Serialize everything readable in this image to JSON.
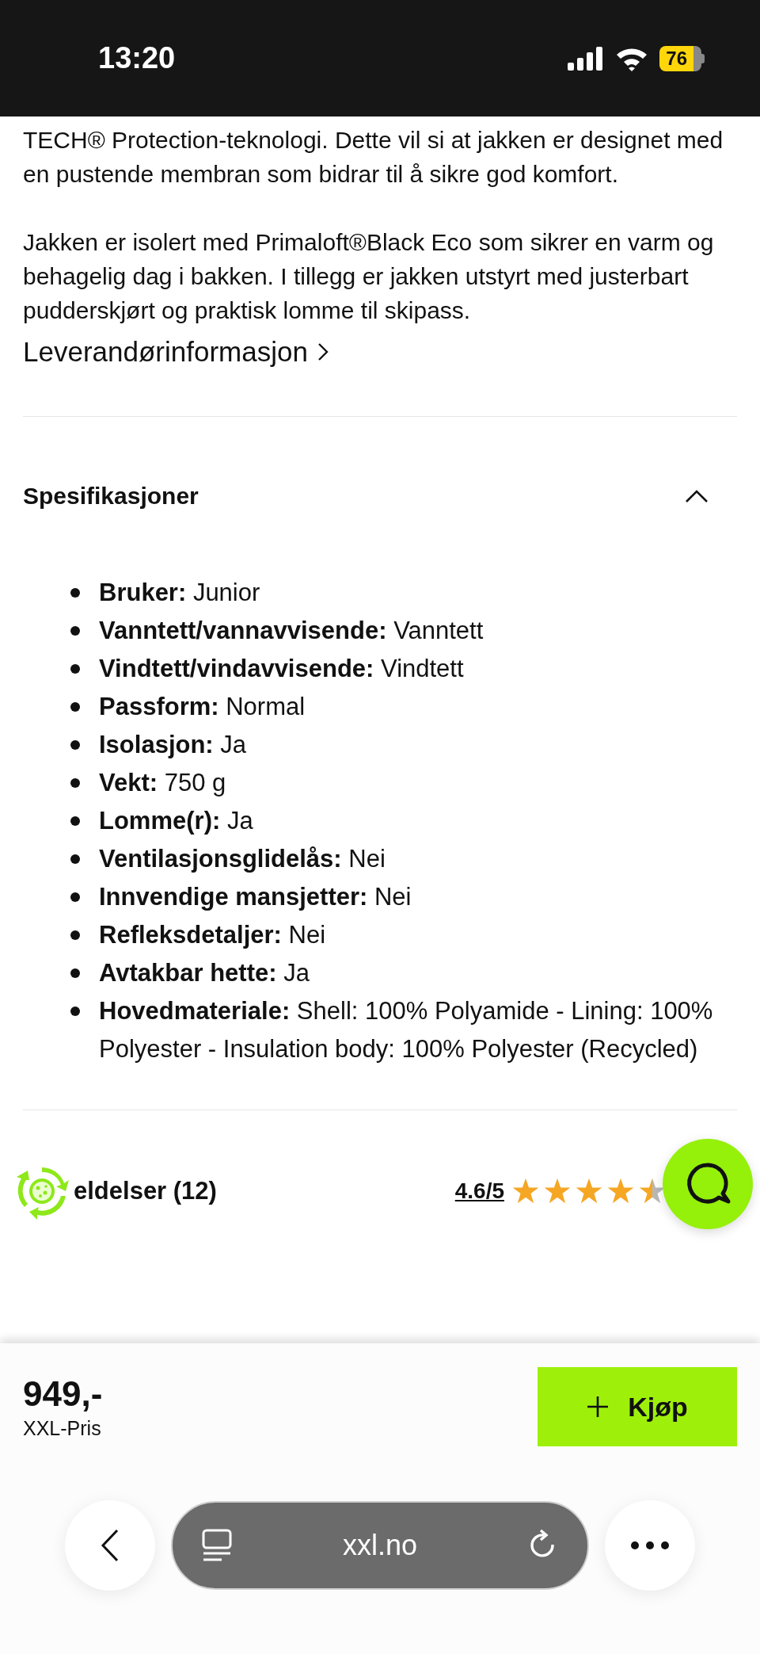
{
  "status_bar": {
    "time": "13:20",
    "battery": "76"
  },
  "description": {
    "paragraphs": [
      "TECH® Protection-teknologi. Dette vil si at jakken er designet med en pustende membran som bidrar til å sikre god komfort.",
      "Jakken er isolert med Primaloft®Black Eco som sikrer en varm og behagelig dag i bakken. I tillegg er jakken utstyrt med justerbart pudderskjørt og praktisk lomme til skipass."
    ],
    "link": "Leverandørinformasjon"
  },
  "specifications": {
    "title": "Spesifikasjoner",
    "expanded": true,
    "items": [
      {
        "label": "Bruker:",
        "value": "Junior"
      },
      {
        "label": "Vanntett/vannavvisende:",
        "value": "Vanntett"
      },
      {
        "label": "Vindtett/vindavvisende:",
        "value": "Vindtett"
      },
      {
        "label": "Passform:",
        "value": "Normal"
      },
      {
        "label": "Isolasjon:",
        "value": "Ja"
      },
      {
        "label": "Vekt:",
        "value": "750 g"
      },
      {
        "label": "Lomme(r):",
        "value": "Ja"
      },
      {
        "label": "Ventilasjonsglidelås:",
        "value": "Nei"
      },
      {
        "label": "Innvendige mansjetter:",
        "value": "Nei"
      },
      {
        "label": "Refleksdetaljer:",
        "value": "Nei"
      },
      {
        "label": "Avtakbar hette:",
        "value": "Ja"
      },
      {
        "label": "Hovedmateriale:",
        "value": "Shell: 100% Polyamide - Lining: 100% Polyester - Insulation body: 100% Polyester (Recycled)"
      }
    ]
  },
  "reviews": {
    "title": "eldelser (12)",
    "rating": "4.6/5",
    "stars": 4.5
  },
  "purchase": {
    "price": "949,-",
    "price_label": "XXL-Pris",
    "button": "Kjøp"
  },
  "browser": {
    "url": "xxl.no"
  }
}
